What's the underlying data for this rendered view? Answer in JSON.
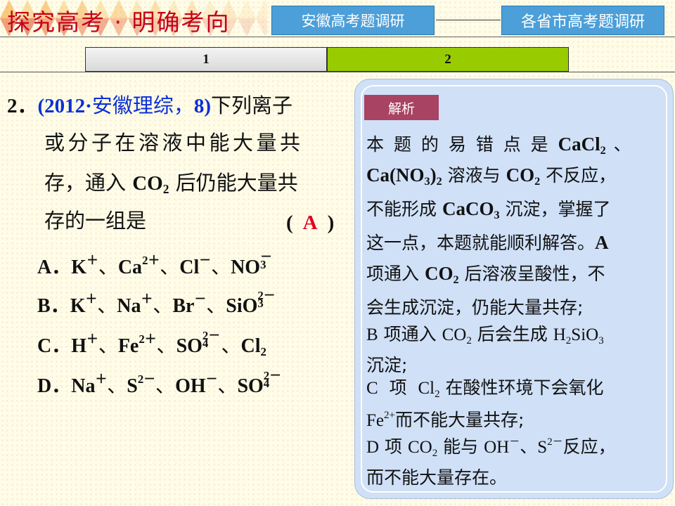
{
  "header": {
    "title": "探究高考 · 明确考向",
    "nav_left": "安徽高考题调研",
    "nav_right": "各省市高考题调研"
  },
  "tabs": [
    {
      "label": "1",
      "active": false
    },
    {
      "label": "2",
      "active": true
    }
  ],
  "question": {
    "number": "2．",
    "source_open": "(2012·",
    "source_cn": "安徽理综，",
    "source_close": "8)",
    "line1_tail": "下列离子",
    "line2": "或分子在溶液中能大量共",
    "line3_pre": "存，通入 ",
    "line3_co": "CO",
    "line3_sub": "2",
    "line3_post": " 后仍能大量共",
    "line4": "存的一组是",
    "paren_open": "(",
    "answer": "A",
    "paren_close": ")"
  },
  "options": [
    {
      "label": "A．",
      "text": "K⁺、Ca²⁺、Cl⁻、NO₃⁻"
    },
    {
      "label": "B．",
      "text": "K⁺、Na⁺、Br⁻、SiO₃²⁻"
    },
    {
      "label": "C．",
      "text": "H⁺、Fe²⁺、SO₄²⁻、Cl₂"
    },
    {
      "label": "D．",
      "text": "Na⁺、S²⁻、OH⁻、SO₄²⁻"
    }
  ],
  "analysis": {
    "badge": "解析",
    "l1_pre": "本 题 的 易 错 点 是 ",
    "l1_chem": "CaCl",
    "l1_sub": "2",
    "l1_post": " 、",
    "l2_chem": "Ca(NO",
    "l2_sub": "3",
    "l2_chem2": ")",
    "l2_sub2": "2",
    "l2_mid": " 溶液与 ",
    "l2_co": "CO",
    "l2_co_sub": "2",
    "l2_post": " 不反应，",
    "l3_pre": "不能形成 ",
    "l3_chem": "CaCO",
    "l3_sub": "3",
    "l3_post": " 沉淀，掌握了",
    "l4_pre": "这一点，本题就能顺利解答。",
    "l4_a": "A",
    "l5_pre": "项通入 ",
    "l5_chem": "CO",
    "l5_sub": "2",
    "l5_post": " 后溶液呈酸性，不",
    "l6": "会生成沉淀，仍能大量共存;",
    "l7_b": "B",
    "l7_pre": " 项通入 ",
    "l7_co": "CO",
    "l7_co_sub": "2",
    "l7_mid": " 后会生成 ",
    "l7_h": "H",
    "l7_h_sub": "2",
    "l7_sio": "SiO",
    "l7_sio_sub": "3",
    "l8": "沉淀;",
    "l9_c": "C",
    "l9_pre": "  项  ",
    "l9_cl": "Cl",
    "l9_cl_sub": "2",
    "l9_post": " 在酸性环境下会氧化",
    "l10_fe": "Fe",
    "l10_fe_sup": "2+",
    "l10_post": "而不能大量共存;",
    "l11_d": "D",
    "l11_pre": " 项 ",
    "l11_co": "CO",
    "l11_co_sub": "2",
    "l11_mid": " 能与 ",
    "l11_oh": "OH",
    "l11_oh_sup": "－",
    "l11_mid2": "、",
    "l11_s": "S",
    "l11_s_sup": "2－",
    "l11_post": "反应，",
    "l12": "而不能大量存在。"
  },
  "colors": {
    "title": "#c5001a",
    "nav_bg": "#4c9fd8",
    "tab_active": "#99cc00",
    "source_blue": "#0a2fd6",
    "answer_red": "#e3001b",
    "panel_bg": "#cfe0f7",
    "badge_bg": "#a94363"
  }
}
